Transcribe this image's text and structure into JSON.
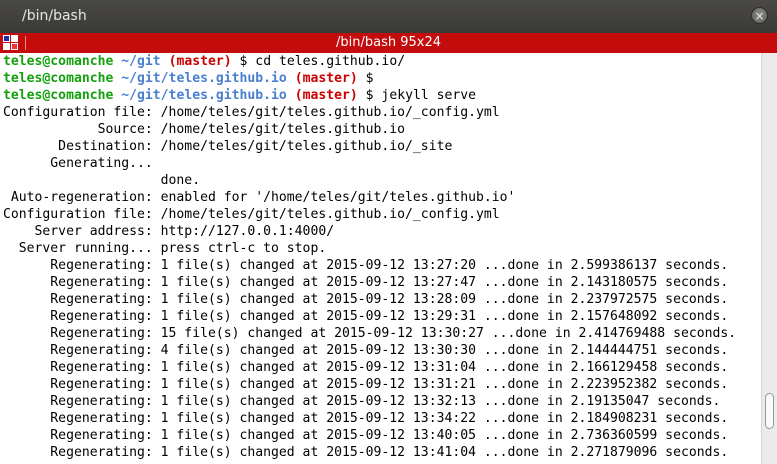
{
  "window": {
    "title": "/bin/bash",
    "close_label": "×"
  },
  "tab": {
    "title": "/bin/bash 95x24"
  },
  "prompts": [
    {
      "user": "teles@comanche",
      "path": " ~/git",
      "branch": " (master)",
      "symbol": " $",
      "command": " cd teles.github.io/"
    },
    {
      "user": "teles@comanche",
      "path": " ~/git/teles.github.io",
      "branch": " (master)",
      "symbol": " $",
      "command": ""
    },
    {
      "user": "teles@comanche",
      "path": " ~/git/teles.github.io",
      "branch": " (master)",
      "symbol": " $",
      "command": " jekyll serve"
    }
  ],
  "output": [
    "Configuration file: /home/teles/git/teles.github.io/_config.yml",
    "            Source: /home/teles/git/teles.github.io",
    "       Destination: /home/teles/git/teles.github.io/_site",
    "      Generating...",
    "                    done.",
    " Auto-regeneration: enabled for '/home/teles/git/teles.github.io'",
    "Configuration file: /home/teles/git/teles.github.io/_config.yml",
    "    Server address: http://127.0.0.1:4000/",
    "  Server running... press ctrl-c to stop.",
    "      Regenerating: 1 file(s) changed at 2015-09-12 13:27:20 ...done in 2.599386137 seconds.",
    "      Regenerating: 1 file(s) changed at 2015-09-12 13:27:47 ...done in 2.143180575 seconds.",
    "      Regenerating: 1 file(s) changed at 2015-09-12 13:28:09 ...done in 2.237972575 seconds.",
    "      Regenerating: 1 file(s) changed at 2015-09-12 13:29:31 ...done in 2.157648092 seconds.",
    "      Regenerating: 15 file(s) changed at 2015-09-12 13:30:27 ...done in 2.414769488 seconds.",
    "      Regenerating: 4 file(s) changed at 2015-09-12 13:30:30 ...done in 2.144444751 seconds.",
    "      Regenerating: 1 file(s) changed at 2015-09-12 13:31:04 ...done in 2.166129458 seconds.",
    "      Regenerating: 1 file(s) changed at 2015-09-12 13:31:21 ...done in 2.223952382 seconds.",
    "      Regenerating: 1 file(s) changed at 2015-09-12 13:32:13 ...done in 2.19135047 seconds.",
    "      Regenerating: 1 file(s) changed at 2015-09-12 13:34:22 ...done in 2.184908231 seconds.",
    "      Regenerating: 1 file(s) changed at 2015-09-12 13:40:05 ...done in 2.736360599 seconds.",
    "      Regenerating: 1 file(s) changed at 2015-09-12 13:41:04 ...done in 2.271879096 seconds."
  ],
  "colors": {
    "user": "#13a10e",
    "path": "#4a7fcf",
    "branch": "#cc0000",
    "tabbar": "#c40c0c"
  },
  "icons": {
    "tab": "terminal-split-icon",
    "close": "close-icon"
  }
}
